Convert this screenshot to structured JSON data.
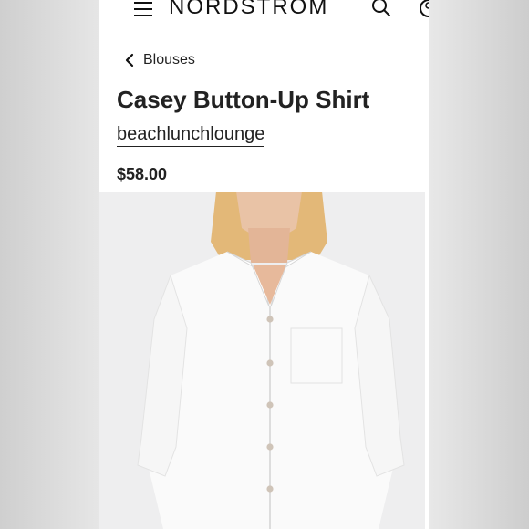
{
  "header": {
    "logo": "NORDSTROM"
  },
  "breadcrumb": {
    "label": "Blouses"
  },
  "product": {
    "title": "Casey Button-Up Shirt",
    "brand": "beachlunchlounge",
    "price": "$58.00"
  },
  "icons": {
    "menu": "hamburger-menu-icon",
    "search": "search-icon",
    "account": "account-icon",
    "back": "chevron-left-icon"
  }
}
